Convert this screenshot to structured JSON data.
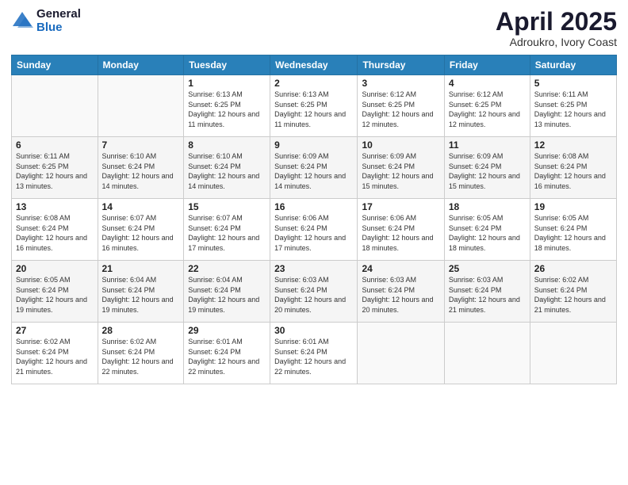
{
  "logo": {
    "general": "General",
    "blue": "Blue"
  },
  "title": "April 2025",
  "subtitle": "Adroukro, Ivory Coast",
  "weekdays": [
    "Sunday",
    "Monday",
    "Tuesday",
    "Wednesday",
    "Thursday",
    "Friday",
    "Saturday"
  ],
  "weeks": [
    [
      {
        "day": "",
        "info": ""
      },
      {
        "day": "",
        "info": ""
      },
      {
        "day": "1",
        "info": "Sunrise: 6:13 AM\nSunset: 6:25 PM\nDaylight: 12 hours and 11 minutes."
      },
      {
        "day": "2",
        "info": "Sunrise: 6:13 AM\nSunset: 6:25 PM\nDaylight: 12 hours and 11 minutes."
      },
      {
        "day": "3",
        "info": "Sunrise: 6:12 AM\nSunset: 6:25 PM\nDaylight: 12 hours and 12 minutes."
      },
      {
        "day": "4",
        "info": "Sunrise: 6:12 AM\nSunset: 6:25 PM\nDaylight: 12 hours and 12 minutes."
      },
      {
        "day": "5",
        "info": "Sunrise: 6:11 AM\nSunset: 6:25 PM\nDaylight: 12 hours and 13 minutes."
      }
    ],
    [
      {
        "day": "6",
        "info": "Sunrise: 6:11 AM\nSunset: 6:25 PM\nDaylight: 12 hours and 13 minutes."
      },
      {
        "day": "7",
        "info": "Sunrise: 6:10 AM\nSunset: 6:24 PM\nDaylight: 12 hours and 14 minutes."
      },
      {
        "day": "8",
        "info": "Sunrise: 6:10 AM\nSunset: 6:24 PM\nDaylight: 12 hours and 14 minutes."
      },
      {
        "day": "9",
        "info": "Sunrise: 6:09 AM\nSunset: 6:24 PM\nDaylight: 12 hours and 14 minutes."
      },
      {
        "day": "10",
        "info": "Sunrise: 6:09 AM\nSunset: 6:24 PM\nDaylight: 12 hours and 15 minutes."
      },
      {
        "day": "11",
        "info": "Sunrise: 6:09 AM\nSunset: 6:24 PM\nDaylight: 12 hours and 15 minutes."
      },
      {
        "day": "12",
        "info": "Sunrise: 6:08 AM\nSunset: 6:24 PM\nDaylight: 12 hours and 16 minutes."
      }
    ],
    [
      {
        "day": "13",
        "info": "Sunrise: 6:08 AM\nSunset: 6:24 PM\nDaylight: 12 hours and 16 minutes."
      },
      {
        "day": "14",
        "info": "Sunrise: 6:07 AM\nSunset: 6:24 PM\nDaylight: 12 hours and 16 minutes."
      },
      {
        "day": "15",
        "info": "Sunrise: 6:07 AM\nSunset: 6:24 PM\nDaylight: 12 hours and 17 minutes."
      },
      {
        "day": "16",
        "info": "Sunrise: 6:06 AM\nSunset: 6:24 PM\nDaylight: 12 hours and 17 minutes."
      },
      {
        "day": "17",
        "info": "Sunrise: 6:06 AM\nSunset: 6:24 PM\nDaylight: 12 hours and 18 minutes."
      },
      {
        "day": "18",
        "info": "Sunrise: 6:05 AM\nSunset: 6:24 PM\nDaylight: 12 hours and 18 minutes."
      },
      {
        "day": "19",
        "info": "Sunrise: 6:05 AM\nSunset: 6:24 PM\nDaylight: 12 hours and 18 minutes."
      }
    ],
    [
      {
        "day": "20",
        "info": "Sunrise: 6:05 AM\nSunset: 6:24 PM\nDaylight: 12 hours and 19 minutes."
      },
      {
        "day": "21",
        "info": "Sunrise: 6:04 AM\nSunset: 6:24 PM\nDaylight: 12 hours and 19 minutes."
      },
      {
        "day": "22",
        "info": "Sunrise: 6:04 AM\nSunset: 6:24 PM\nDaylight: 12 hours and 19 minutes."
      },
      {
        "day": "23",
        "info": "Sunrise: 6:03 AM\nSunset: 6:24 PM\nDaylight: 12 hours and 20 minutes."
      },
      {
        "day": "24",
        "info": "Sunrise: 6:03 AM\nSunset: 6:24 PM\nDaylight: 12 hours and 20 minutes."
      },
      {
        "day": "25",
        "info": "Sunrise: 6:03 AM\nSunset: 6:24 PM\nDaylight: 12 hours and 21 minutes."
      },
      {
        "day": "26",
        "info": "Sunrise: 6:02 AM\nSunset: 6:24 PM\nDaylight: 12 hours and 21 minutes."
      }
    ],
    [
      {
        "day": "27",
        "info": "Sunrise: 6:02 AM\nSunset: 6:24 PM\nDaylight: 12 hours and 21 minutes."
      },
      {
        "day": "28",
        "info": "Sunrise: 6:02 AM\nSunset: 6:24 PM\nDaylight: 12 hours and 22 minutes."
      },
      {
        "day": "29",
        "info": "Sunrise: 6:01 AM\nSunset: 6:24 PM\nDaylight: 12 hours and 22 minutes."
      },
      {
        "day": "30",
        "info": "Sunrise: 6:01 AM\nSunset: 6:24 PM\nDaylight: 12 hours and 22 minutes."
      },
      {
        "day": "",
        "info": ""
      },
      {
        "day": "",
        "info": ""
      },
      {
        "day": "",
        "info": ""
      }
    ]
  ]
}
